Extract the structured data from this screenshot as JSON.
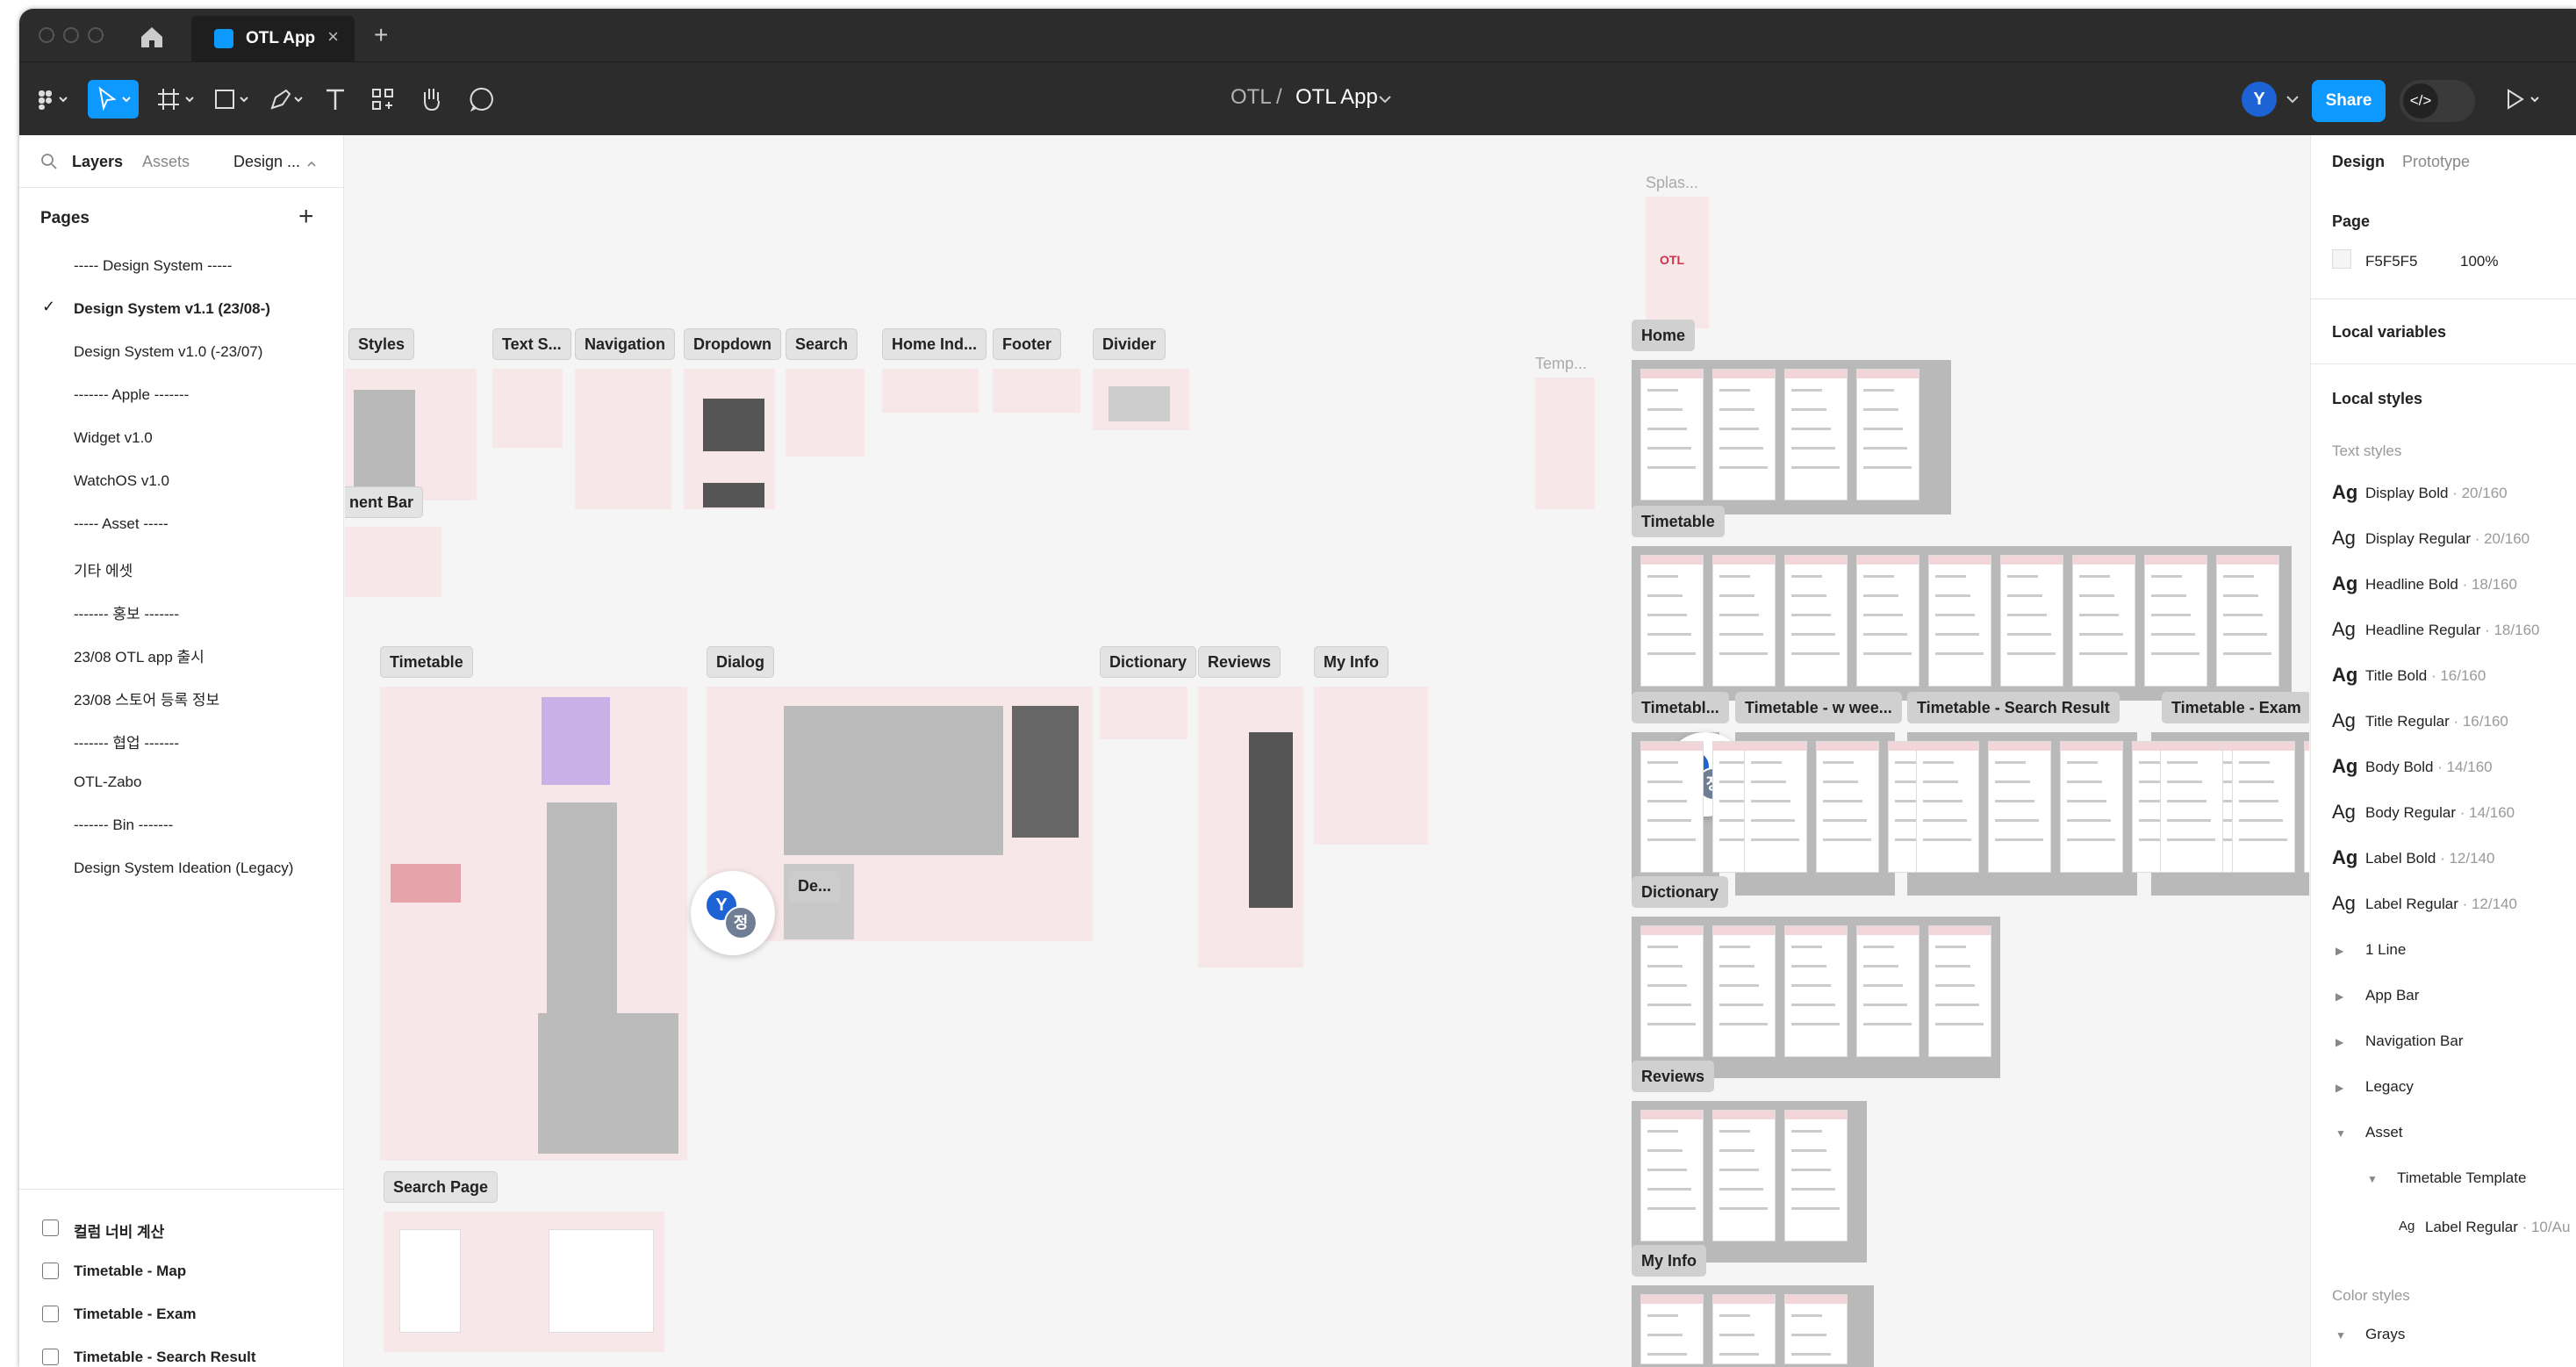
{
  "window": {
    "tab_title": "OTL App",
    "tab_close": "×",
    "new_tab": "+"
  },
  "toolbar": {
    "crumb_parent": "OTL",
    "crumb_sep": "/",
    "crumb_current": "OTL App",
    "user_initial": "Y",
    "share_label": "Share",
    "dev_mode_label": "</>"
  },
  "left_panel": {
    "tabs": [
      "Layers",
      "Assets",
      "Design ..."
    ],
    "pages_title": "Pages",
    "pages": [
      {
        "label": "----- Design System -----",
        "selected": false
      },
      {
        "label": "Design System v1.1 (23/08-)",
        "selected": true
      },
      {
        "label": "Design System v1.0 (-23/07)",
        "selected": false
      },
      {
        "label": "------- Apple -------",
        "selected": false
      },
      {
        "label": "Widget v1.0",
        "selected": false
      },
      {
        "label": "WatchOS v1.0",
        "selected": false
      },
      {
        "label": "----- Asset -----",
        "selected": false
      },
      {
        "label": "기타 에셋",
        "selected": false
      },
      {
        "label": "------- 홍보 -------",
        "selected": false
      },
      {
        "label": "23/08 OTL app 출시",
        "selected": false
      },
      {
        "label": "23/08 스토어 등록 정보",
        "selected": false
      },
      {
        "label": "------- 협업 -------",
        "selected": false
      },
      {
        "label": "OTL-Zabo",
        "selected": false
      },
      {
        "label": "------- Bin -------",
        "selected": false
      },
      {
        "label": "Design System Ideation (Legacy)",
        "selected": false
      }
    ],
    "layers": [
      "컬럼 너비 계산",
      "Timetable - Map",
      "Timetable - Exam",
      "Timetable - Search Result"
    ],
    "check": "✓"
  },
  "right_panel": {
    "tabs": [
      "Design",
      "Prototype"
    ],
    "page_title": "Page",
    "page_color": "F5F5F5",
    "page_opacity": "100%",
    "local_variables": "Local variables",
    "local_styles": "Local styles",
    "text_styles_title": "Text styles",
    "ag": "Ag",
    "text_styles": [
      {
        "name": "Display Bold",
        "size": " · 20/160"
      },
      {
        "name": "Display Regular",
        "size": " · 20/160"
      },
      {
        "name": "Headline Bold",
        "size": " · 18/160"
      },
      {
        "name": "Headline Regular",
        "size": " · 18/160"
      },
      {
        "name": "Title Bold",
        "size": " · 16/160"
      },
      {
        "name": "Title Regular",
        "size": " · 16/160"
      },
      {
        "name": "Body Bold",
        "size": " · 14/160"
      },
      {
        "name": "Body Regular",
        "size": " · 14/160"
      },
      {
        "name": "Label Bold",
        "size": " · 12/140"
      },
      {
        "name": "Label Regular",
        "size": " · 12/140"
      }
    ],
    "groups": [
      "1 Line",
      "App Bar",
      "Navigation Bar",
      "Legacy",
      "Asset",
      "Timetable Template"
    ],
    "nested_style": "Label Regular",
    "nested_style_size": " · 10/Au",
    "color_styles_title": "Color styles",
    "color_group": "Grays"
  },
  "canvas": {
    "labels": {
      "styles": "Styles",
      "text_s": "Text S...",
      "navigation": "Navigation",
      "dropdown": "Dropdown",
      "search": "Search",
      "home_ind": "Home Ind...",
      "footer": "Footer",
      "divider": "Divider",
      "ment_bar": "nent Bar",
      "timetable": "Timetable",
      "dialog": "Dialog",
      "dictionary": "Dictionary",
      "reviews": "Reviews",
      "my_info": "My Info",
      "search_page": "Search Page",
      "de": "De...",
      "home": "Home",
      "timetable_r": "Timetable",
      "timetabl": "Timetabl...",
      "tt_week": "Timetable - w wee...",
      "tt_search": "Timetable - Search Result",
      "tt_exam": "Timetable - Exam",
      "dictionary_r": "Dictionary",
      "reviews_r": "Reviews",
      "my_info_r": "My Info",
      "splash": "Splas...",
      "temp": "Temp...",
      "otl_logo": "OTL"
    },
    "cursor_a": "Y",
    "cursor_b": "정"
  }
}
